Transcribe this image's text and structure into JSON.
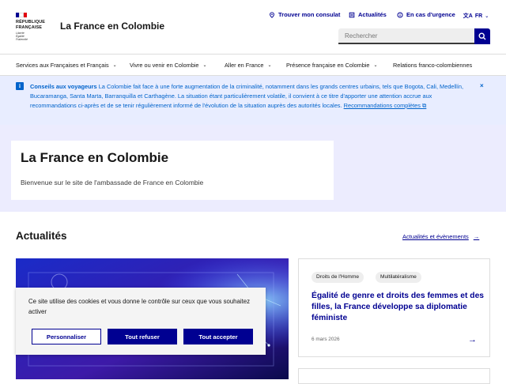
{
  "header": {
    "logo_lines": [
      "RÉPUBLIQUE",
      "FRANÇAISE"
    ],
    "logo_motto": [
      "Liberté",
      "Égalité",
      "Fraternité"
    ],
    "site_title": "La France en Colombie",
    "tools": {
      "consulate": "Trouver mon consulat",
      "news": "Actualités",
      "emergency": "En cas d'urgence"
    },
    "lang": "FR",
    "search_placeholder": "Rechercher"
  },
  "nav": {
    "items": [
      {
        "label": "Services aux Françaises et Français"
      },
      {
        "label": "Vivre ou venir en Colombie"
      },
      {
        "label": "Aller en France"
      },
      {
        "label": "Présence française en Colombie"
      },
      {
        "label": "Relations franco-colombiennes"
      }
    ]
  },
  "notice": {
    "heading": "Conseils aux voyageurs",
    "body": "La Colombie fait face à une forte augmentation de la criminalité, notamment dans les grands centres urbains, tels que Bogota, Cali, Medellín, Bucaramanga, Santa Marta, Barranquilla et Carthagène. La situation étant particulièrement volatile, il convient à ce titre d'apporter une attention accrue aux recommandations ci-après et de se tenir régulièrement informé de l'évolution de la situation auprès des autorités locales.",
    "link": "Recommandations complètes",
    "close": "×"
  },
  "hero": {
    "title": "La France en Colombie",
    "subtitle": "Bienvenue sur le site de l'ambassade de France en Colombie"
  },
  "news": {
    "title": "Actualités",
    "all_link": "Actualités et évènements",
    "card": {
      "tags": [
        "Droits de l'Homme",
        "Multilatéralisme"
      ],
      "title": "Égalité de genre et droits des femmes et des filles, la France développe sa diplomatie féministe",
      "date": "6 mars 2026"
    }
  },
  "cookie": {
    "text": "Ce site utilise des cookies et vous donne le contrôle sur ceux que vous souhaitez activer",
    "customize": "Personnaliser",
    "refuse": "Tout refuser",
    "accept": "Tout accepter"
  },
  "colors": {
    "primary": "#000091",
    "info": "#0063cb",
    "flag_blue": "#000091",
    "flag_red": "#e1000f"
  }
}
